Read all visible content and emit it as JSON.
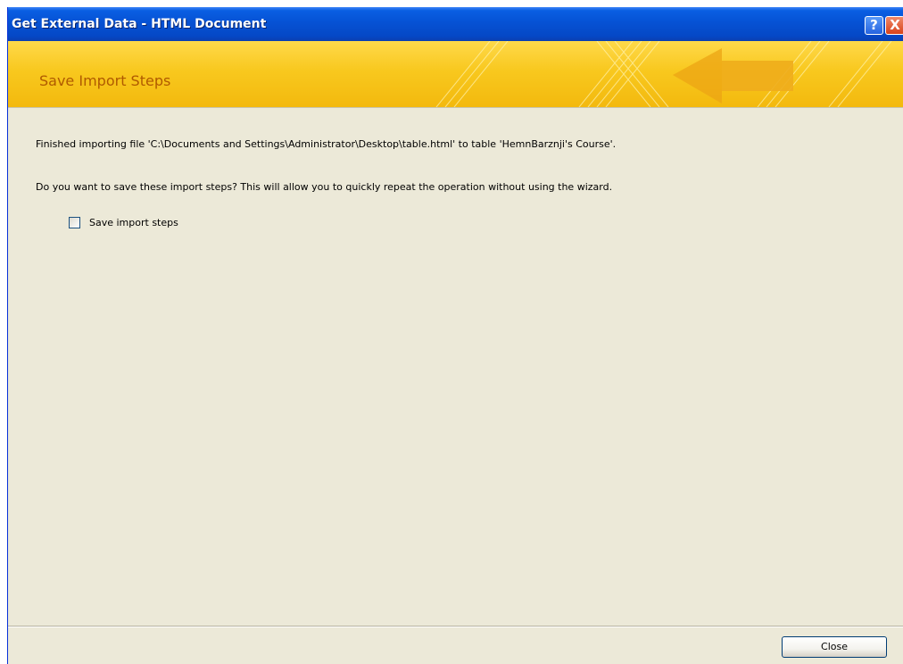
{
  "window": {
    "title": "Get External Data - HTML Document",
    "help_label": "?",
    "close_label": "X"
  },
  "banner": {
    "title": "Save Import Steps"
  },
  "content": {
    "finished_message": "Finished importing file 'C:\\Documents and Settings\\Administrator\\Desktop\\table.html' to table 'HemnBarznji's Course'.",
    "save_question": "Do you want to save these import steps? This will allow you to quickly repeat the operation without using the wizard.",
    "save_checkbox_label": "Save import steps",
    "save_checkbox_checked": false
  },
  "footer": {
    "close_button_label": "Close"
  },
  "colors": {
    "titlebar": "#0653d6",
    "banner": "#f8c81e",
    "banner_title": "#b05a00",
    "dialog_bg": "#ECE9D8"
  }
}
